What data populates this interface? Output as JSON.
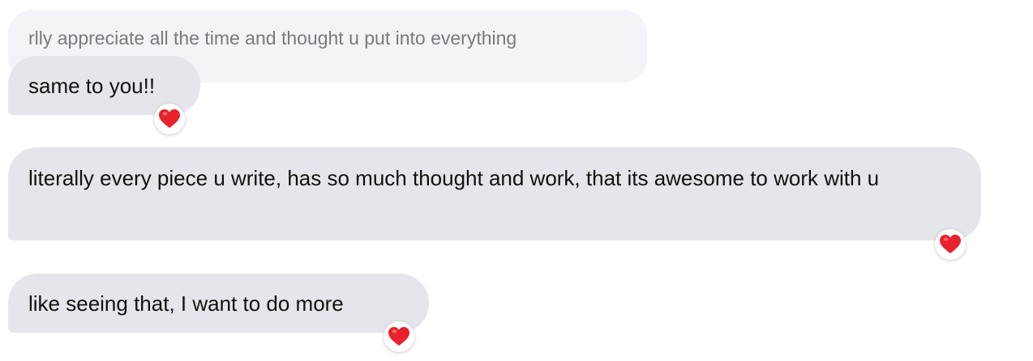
{
  "thread": {
    "quoted_message": {
      "text": "rlly appreciate all the time and thought u put into everything"
    },
    "messages": [
      {
        "text": "same to you!!",
        "reaction": "heart-icon"
      },
      {
        "text": "literally every piece u write, has so much thought and work, that its awesome to work with u",
        "reaction": "heart-icon"
      },
      {
        "text": "like seeing that, I want to do more",
        "reaction": "heart-icon"
      }
    ]
  },
  "colors": {
    "bubble": "#e5e6eb",
    "quoted_bubble": "#f3f4f7",
    "quoted_text": "#777a80",
    "heart": "#e8222b"
  }
}
